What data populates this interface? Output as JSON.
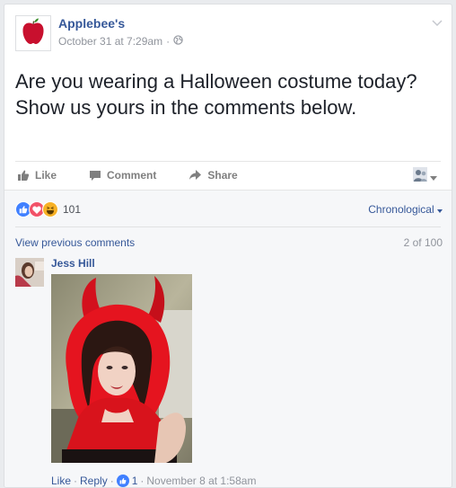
{
  "post": {
    "page_name": "Applebee's",
    "timestamp": "October 31 at 7:29am",
    "separator": "·",
    "text": "Are you wearing a Halloween costume today? Show us yours in the comments below.",
    "logo_icon": "apple-logo-icon",
    "privacy_icon": "globe-icon"
  },
  "actions": {
    "like_label": "Like",
    "comment_label": "Comment",
    "share_label": "Share"
  },
  "reactions": {
    "types": [
      "like",
      "love",
      "haha"
    ],
    "count": "101"
  },
  "comments": {
    "sort_label": "Chronological",
    "view_previous_label": "View previous comments",
    "count_label": "2 of 100",
    "items": [
      {
        "author": "Jess Hill",
        "like_label": "Like",
        "reply_label": "Reply",
        "like_count": "1",
        "time": "November 8 at 1:58am"
      }
    ]
  },
  "colors": {
    "link": "#365899",
    "meta": "#90949c",
    "like_blue": "#4080ff",
    "love_red": "#f25268",
    "haha_yellow": "#f7b125",
    "apple_red": "#c8102e"
  }
}
